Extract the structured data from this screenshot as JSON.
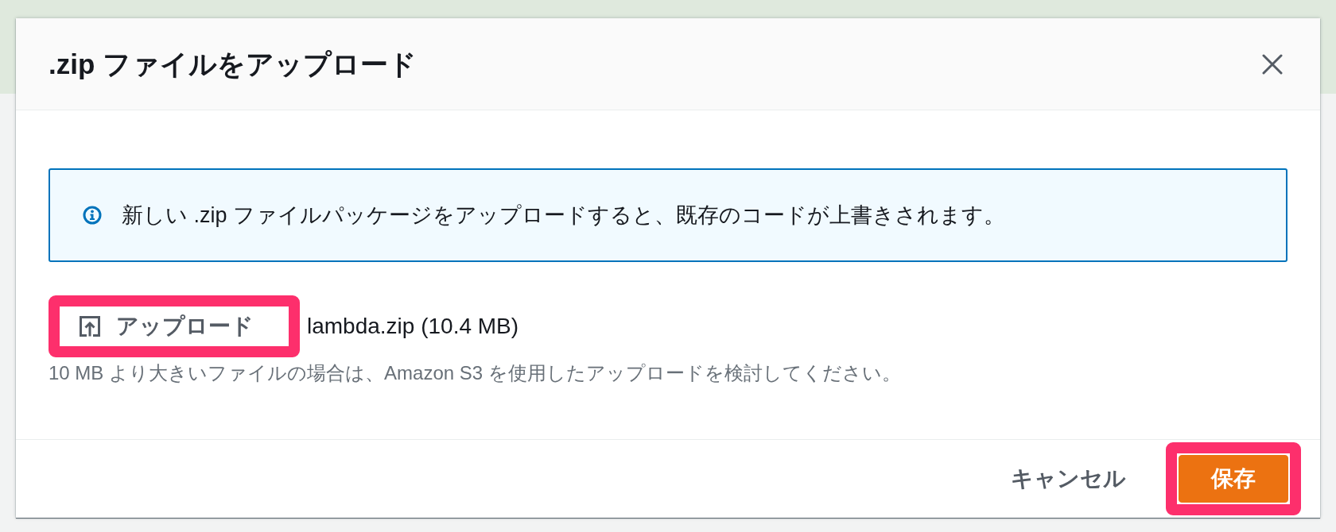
{
  "dialog": {
    "title": ".zip ファイルをアップロード"
  },
  "alert": {
    "kind": "info",
    "text": "新しい .zip ファイルパッケージをアップロードすると、既存のコードが上書きされます。"
  },
  "upload": {
    "button": {
      "label": "アップロード",
      "highlighted": true
    },
    "file_name": "lambda.zip (10.4 MB)",
    "hint": "10 MB より大きいファイルの場合は、Amazon S3 を使用したアップロードを検討してください。"
  },
  "footer": {
    "buttons": [
      {
        "label": "キャンセル",
        "kind": "link",
        "highlighted": false
      },
      {
        "label": "保存",
        "kind": "primary",
        "highlighted": true
      }
    ]
  }
}
